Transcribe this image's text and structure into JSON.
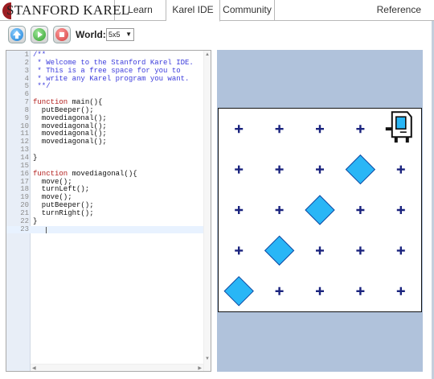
{
  "nav": {
    "brand": "STANFORD KAREL",
    "tabs": [
      "Learn",
      "Karel IDE",
      "Community"
    ],
    "active_tab": "Karel IDE",
    "reference": "Reference"
  },
  "toolbar": {
    "world_label": "World:",
    "world_value": "5x5"
  },
  "editor": {
    "lines": [
      "/**",
      " * Welcome to the Stanford Karel IDE.",
      " * This is a free space for you to",
      " * write any Karel program you want.",
      " **/",
      "",
      "function main(){",
      "  putBeeper();",
      "  movediagonal();",
      "  movediagonal();",
      "  movediagonal();",
      "  movediagonal();",
      "",
      "}",
      "",
      "function movediagonal(){",
      "  move();",
      "  turnLeft();",
      "  move();",
      "  putBeeper();",
      "  turnRight();",
      "}",
      ""
    ],
    "current_line": 23
  },
  "world": {
    "rows": 5,
    "cols": 5,
    "beepers": [
      [
        1,
        1
      ],
      [
        2,
        2
      ],
      [
        3,
        3
      ],
      [
        4,
        4
      ]
    ],
    "karel": {
      "row": 5,
      "col": 5,
      "facing": "east"
    },
    "colors": {
      "corner": "#1a237e",
      "beeper_fill": "#29b6f6",
      "beeper_stroke": "#0d47a1",
      "panel_bg": "#b0c2db"
    }
  }
}
